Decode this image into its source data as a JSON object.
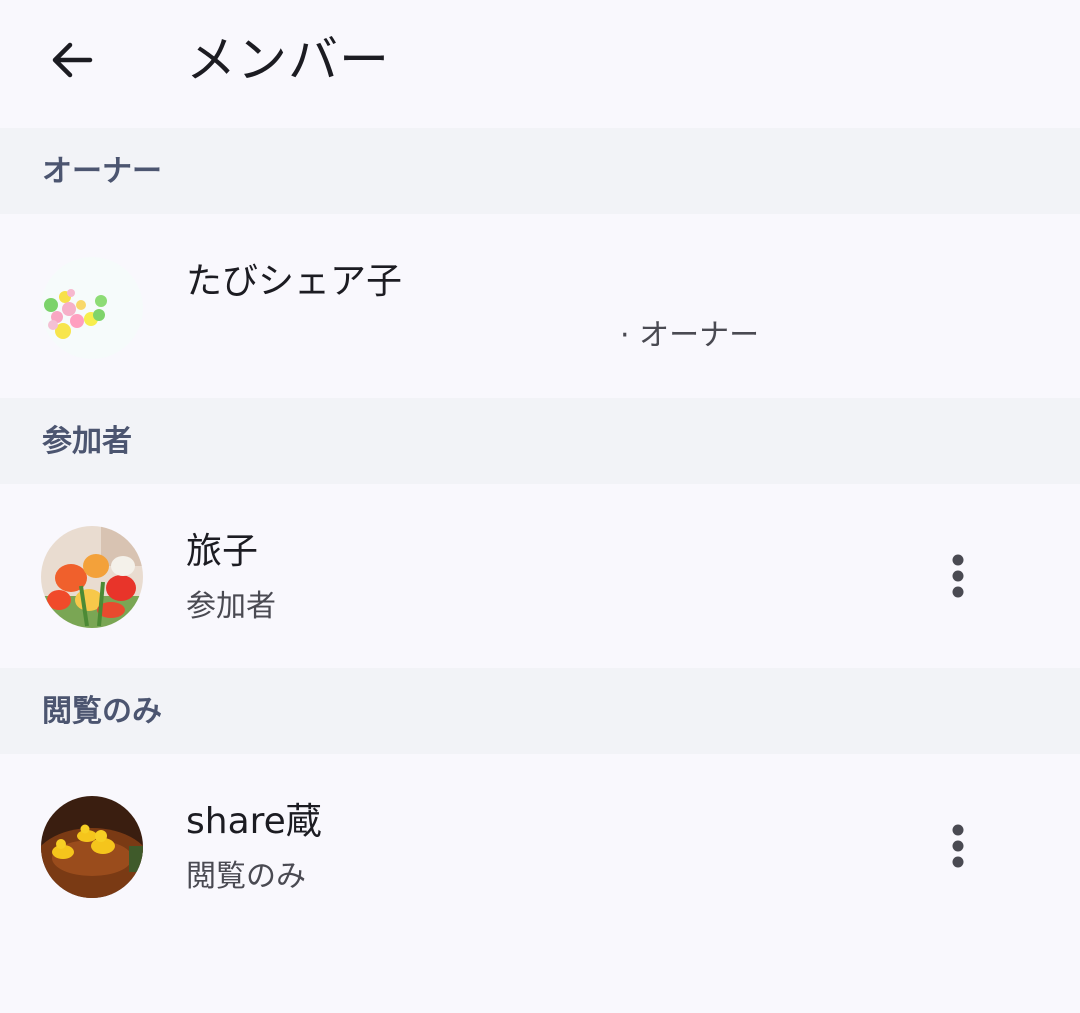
{
  "header": {
    "title": "メンバー",
    "back_icon": "arrow-left-icon"
  },
  "sections": [
    {
      "label": "オーナー",
      "members": [
        {
          "name": "たびシェア子",
          "role": "· オーナー",
          "avatar": "colorful-balls-photo",
          "has_menu": false
        }
      ]
    },
    {
      "label": "参加者",
      "members": [
        {
          "name": "旅子",
          "role": "参加者",
          "avatar": "tulips-photo",
          "has_menu": true
        }
      ]
    },
    {
      "label": "閲覧のみ",
      "members": [
        {
          "name": "share蔵",
          "role": "閲覧のみ",
          "avatar": "rubber-ducks-photo",
          "has_menu": true
        }
      ]
    }
  ],
  "colors": {
    "background": "#f9f8fd",
    "section_background": "#f2f3f7",
    "section_label": "#4c5570",
    "text_primary": "#1c1c22",
    "text_secondary": "#4a4a52"
  }
}
